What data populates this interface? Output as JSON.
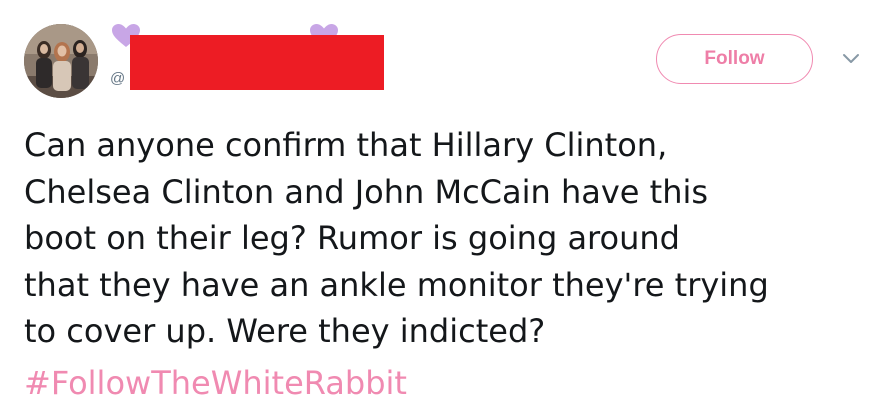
{
  "header": {
    "handle_prefix": "@",
    "follow_label": "Follow",
    "caret_icon": "chevron-down-icon"
  },
  "emoji": {
    "left": "purple-heart-icon",
    "right": "purple-heart-icon",
    "color": "#c8a6e6"
  },
  "redaction_color": "#ed1c24",
  "tweet": {
    "lines": [
      "Can anyone confirm that Hillary Clinton,",
      "Chelsea Clinton and John McCain have this",
      "boot on their leg? Rumor is going around",
      "that they have an ankle monitor they're trying",
      "to cover up. Were they indicted?"
    ],
    "hashtag": "#FollowTheWhiteRabbit"
  },
  "colors": {
    "accent": "#f08ab1",
    "text": "#14171a",
    "muted": "#657786"
  }
}
